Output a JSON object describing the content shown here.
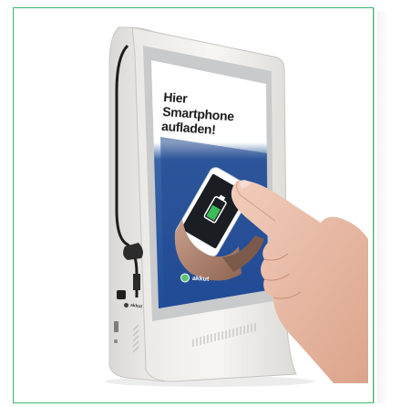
{
  "screen": {
    "headline_line1": "Hier Smartphone",
    "headline_line2": "aufladen!"
  },
  "brand": {
    "name": "akkut",
    "accent_color": "#5ec36f"
  },
  "frame": {
    "border_color": "#3fb86a"
  },
  "icons": [
    "usb-cable-icon",
    "vent-icon",
    "battery-charging-icon"
  ]
}
